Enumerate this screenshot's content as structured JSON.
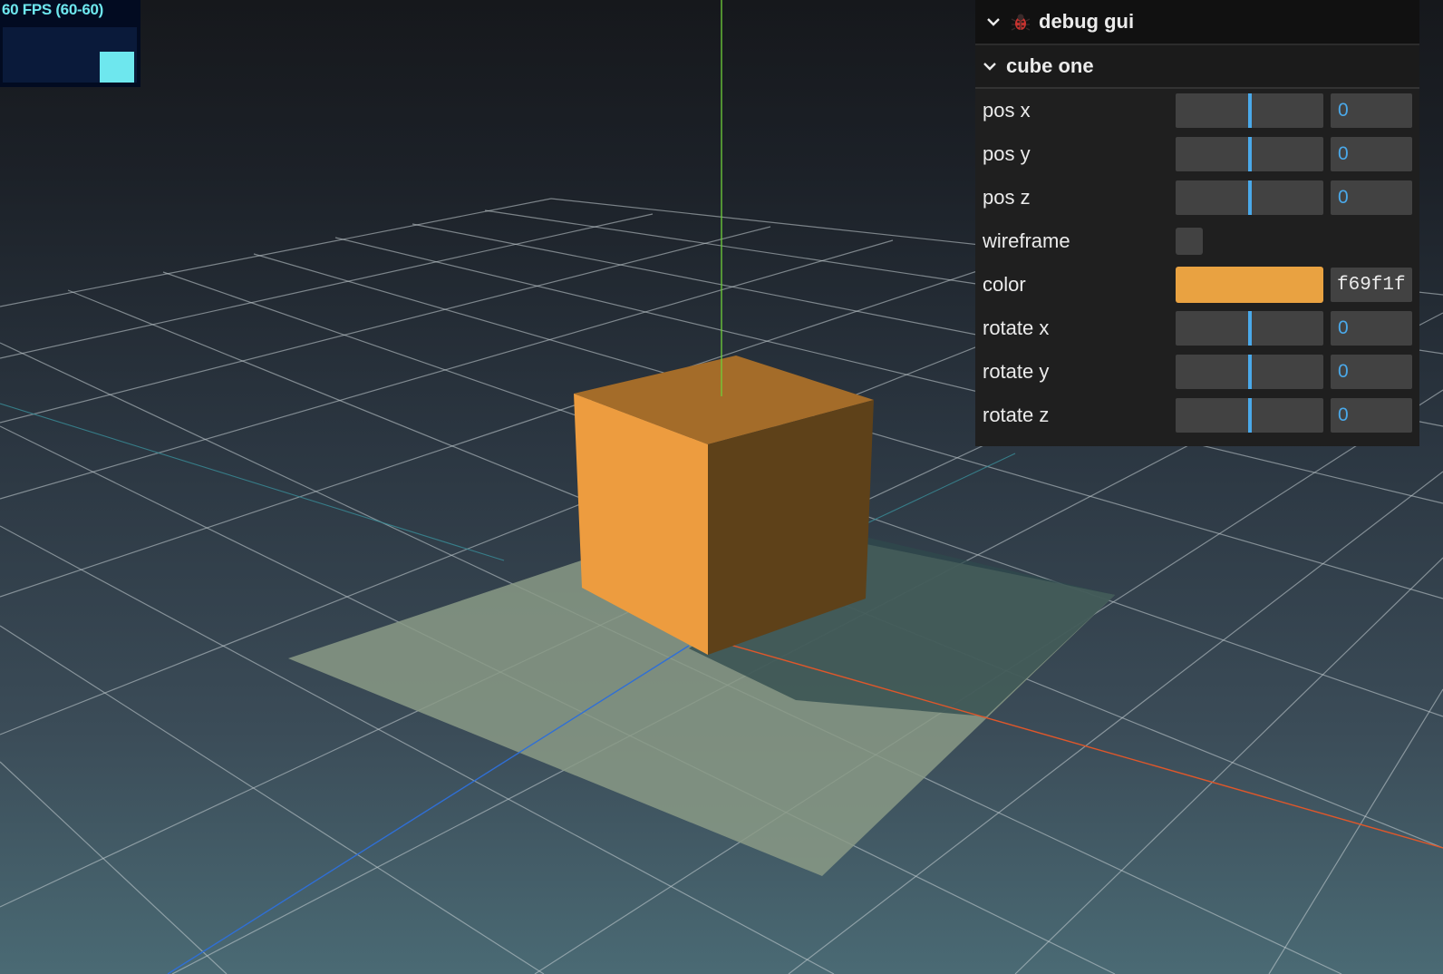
{
  "stats": {
    "label": "60 FPS (60-60)",
    "current_fps": 60,
    "graph_fill": 0.55
  },
  "gui": {
    "title": "debug gui",
    "title_icon": "bug-icon",
    "folder": {
      "title": "cube one",
      "controls": [
        {
          "label": "pos x",
          "type": "slider",
          "value": "0",
          "level": 0.5
        },
        {
          "label": "pos y",
          "type": "slider",
          "value": "0",
          "level": 0.5
        },
        {
          "label": "pos z",
          "type": "slider",
          "value": "0",
          "level": 0.5
        },
        {
          "label": "wireframe",
          "type": "checkbox",
          "checked": false
        },
        {
          "label": "color",
          "type": "color",
          "value": "f69f1f",
          "swatch": "#e9a241"
        },
        {
          "label": "rotate x",
          "type": "slider",
          "value": "0",
          "level": 0.5
        },
        {
          "label": "rotate y",
          "type": "slider",
          "value": "0",
          "level": 0.5
        },
        {
          "label": "rotate z",
          "type": "slider",
          "value": "0",
          "level": 0.5
        }
      ]
    }
  },
  "scene": {
    "cube_color": "#f69f1f",
    "axis_x_color": "#e0572a",
    "axis_y_color": "#6fcf3a",
    "axis_z_color": "#2f6fd6",
    "grid_color": "#cfd6db",
    "plane_color": "#8a9a86"
  }
}
